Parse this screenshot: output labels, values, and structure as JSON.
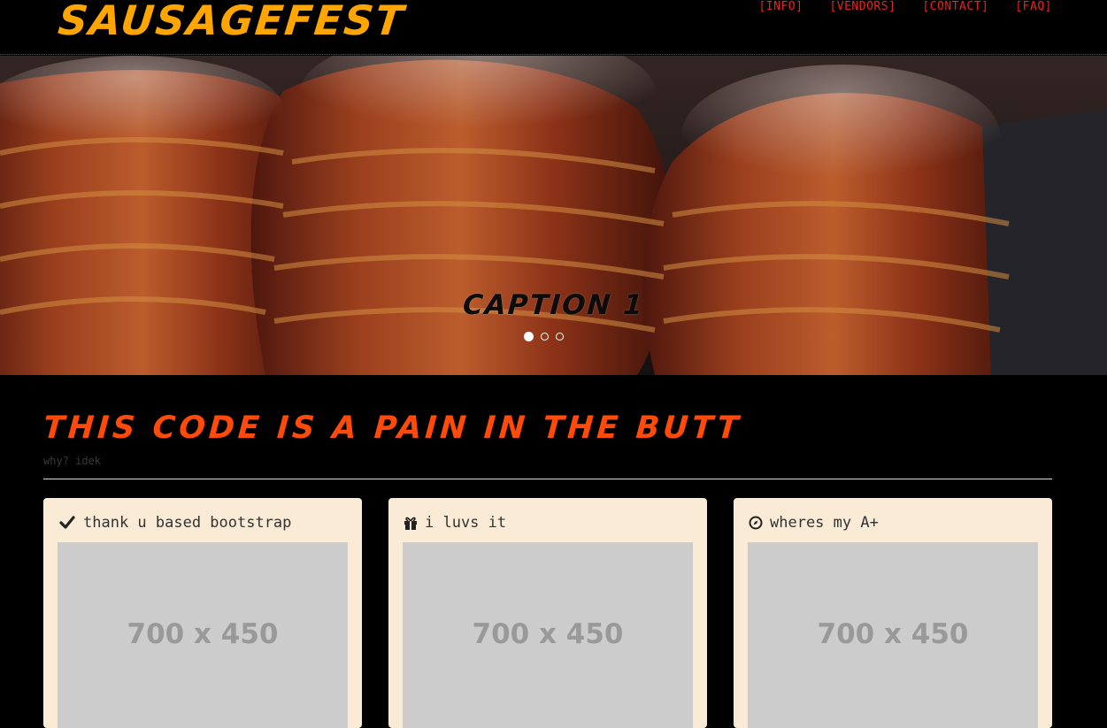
{
  "brand": "SAUSAGEFEST",
  "nav": {
    "items": [
      {
        "label": "[INFO]"
      },
      {
        "label": "[VENDORS]"
      },
      {
        "label": "[CONTACT]"
      },
      {
        "label": "[FAQ]"
      }
    ]
  },
  "carousel": {
    "caption": "CAPTION 1",
    "slide_count": 3,
    "active_index": 0
  },
  "section": {
    "title": "THIS CODE IS A PAIN IN THE BUTT",
    "subtitle": "why? idek"
  },
  "cards": [
    {
      "icon": "check-icon",
      "title": "thank u based bootstrap",
      "placeholder": "700 x 450"
    },
    {
      "icon": "gift-icon",
      "title": "i luvs it",
      "placeholder": "700 x 450"
    },
    {
      "icon": "compass-icon",
      "title": "wheres my A+",
      "placeholder": "700 x 450"
    }
  ],
  "colors": {
    "brand": "#ffa500",
    "nav_link": "#e8241c",
    "section_title": "#ff4a0a",
    "card_bg": "#faebd7",
    "placeholder_bg": "#cccccc"
  }
}
